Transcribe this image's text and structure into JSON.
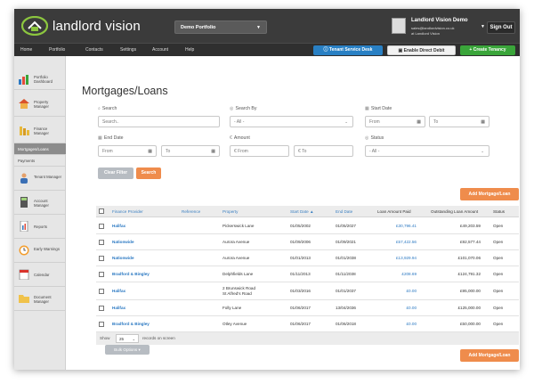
{
  "header": {
    "brand": "landlord vision",
    "portfolio_selector": "Demo Portfolio",
    "user_name": "Landlord Vision Demo",
    "user_email": "sales@landlordvision.co.uk",
    "user_agency": "at Landlord Vision",
    "sign_out": "Sign Out"
  },
  "nav": {
    "items": [
      "Home",
      "Portfolio",
      "Contacts",
      "Settings",
      "Account",
      "Help"
    ],
    "tenant_service_desk": "Tenant Service Desk",
    "enable_direct_debit": "Enable Direct Debit",
    "create_tenancy": "+ Create Tenancy"
  },
  "sidebar": {
    "items": [
      {
        "label": "Portfolio Dashboard",
        "icon": "chart-bars-icon"
      },
      {
        "label": "Property Manager",
        "icon": "house-icon"
      },
      {
        "label": "Finance Manager",
        "icon": "coins-icon"
      },
      {
        "label": "Mortgages/Loans",
        "icon": ""
      },
      {
        "label": "Payments",
        "icon": ""
      },
      {
        "label": "Tenant Manager",
        "icon": "person-icon"
      },
      {
        "label": "Account Manager",
        "icon": "calculator-icon"
      },
      {
        "label": "Reports",
        "icon": "report-icon"
      },
      {
        "label": "Early Warnings",
        "icon": "clock-icon"
      },
      {
        "label": "Calendar",
        "icon": "calendar-icon"
      },
      {
        "label": "Document Manager",
        "icon": "folder-icon"
      }
    ]
  },
  "page": {
    "title": "Mortgages/Loans"
  },
  "filters": {
    "search_label": "Search",
    "search_placeholder": "Search..",
    "search_by_label": "Search By",
    "search_by_value": "- All -",
    "start_date_label": "Start Date",
    "start_from_placeholder": "From",
    "start_to_placeholder": "To",
    "end_date_label": "End Date",
    "end_from_placeholder": "From",
    "end_to_placeholder": "To",
    "amount_label": "Amount",
    "amount_from_placeholder": "From",
    "amount_to_placeholder": "To",
    "currency_symbol": "€",
    "status_label": "Status",
    "status_value": "- All -",
    "clear_filter": "Clear Filter",
    "search_button": "Search"
  },
  "add_button": "Add Mortgage/Loan",
  "table": {
    "headers": [
      "Finance Provider",
      "Reference",
      "Property",
      "Start Date ▲",
      "End Date",
      "Loan Amount Paid",
      "Outstanding Loan Amount",
      "Status"
    ],
    "rows": [
      {
        "provider": "Halifax",
        "reference": "",
        "property": "Pickerswick Lane",
        "start": "01/05/2002",
        "end": "01/05/2027",
        "paid": "£30,796.41",
        "outstanding": "£49,203.59",
        "status": "Open"
      },
      {
        "provider": "Nationwide",
        "reference": "",
        "property": "Aurora Avenue",
        "start": "01/09/2006",
        "end": "01/09/2021",
        "paid": "£57,422.56",
        "outstanding": "£92,577.44",
        "status": "Open"
      },
      {
        "provider": "Nationwide",
        "reference": "",
        "property": "Aurora Avenue",
        "start": "01/01/2013",
        "end": "01/01/2038",
        "paid": "£13,929.94",
        "outstanding": "£101,070.06",
        "status": "Open"
      },
      {
        "provider": "Bradford & Bingley",
        "reference": "",
        "property": "Delphfields Lane",
        "start": "01/11/2013",
        "end": "01/11/2038",
        "paid": "£208.69",
        "outstanding": "£124,791.32",
        "status": "Open"
      },
      {
        "provider": "Halifax",
        "reference": "",
        "property": "2 Brunswick Road\nSt Alfred's Road",
        "start": "01/03/2016",
        "end": "01/01/2037",
        "paid": "£0.00",
        "outstanding": "£95,000.00",
        "status": "Open"
      },
      {
        "provider": "Halifax",
        "reference": "",
        "property": "Folly Lane",
        "start": "01/06/2017",
        "end": "13/04/2036",
        "paid": "£0.00",
        "outstanding": "£125,000.00",
        "status": "Open"
      },
      {
        "provider": "Bradford & Bingley",
        "reference": "",
        "property": "Otley Avenue",
        "start": "01/06/2017",
        "end": "01/06/2018",
        "paid": "£0.00",
        "outstanding": "£50,000.00",
        "status": "Open"
      }
    ]
  },
  "footer": {
    "show_label": "Show",
    "page_size": "25",
    "records_label": "records on screen",
    "bulk_options": "Bulk Options ▾"
  }
}
